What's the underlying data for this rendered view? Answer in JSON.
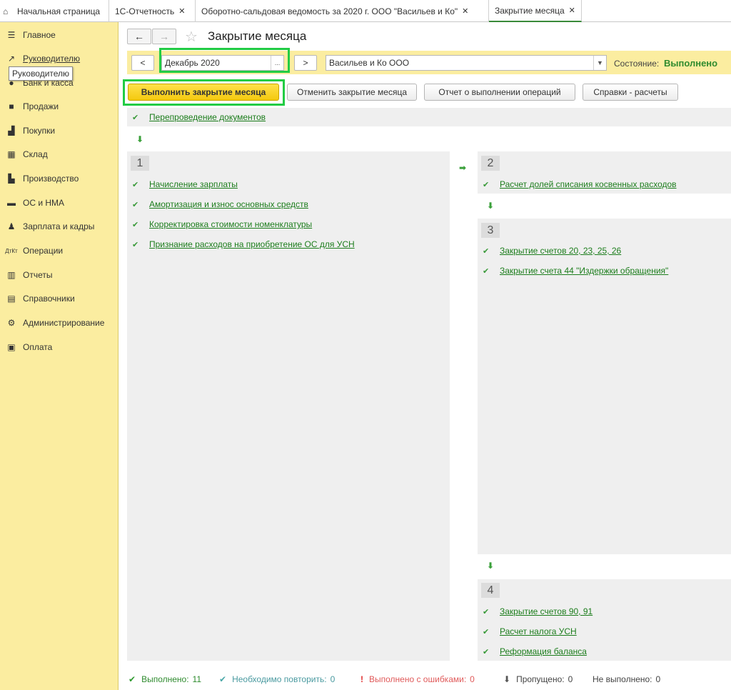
{
  "tabs": [
    {
      "label": "Начальная страница",
      "closable": false,
      "active": false
    },
    {
      "label": "1С-Отчетность",
      "closable": true,
      "active": false
    },
    {
      "label": "Оборотно-сальдовая ведомость за 2020 г. ООО \"Васильев и Ко\"",
      "closable": true,
      "active": false
    },
    {
      "label": "Закрытие месяца",
      "closable": true,
      "active": true
    }
  ],
  "sidebar": {
    "items": [
      {
        "label": "Главное",
        "icon": "menu-icon"
      },
      {
        "label": "Руководителю",
        "icon": "trend-icon"
      },
      {
        "label": "Банк и касса",
        "icon": "bank-icon"
      },
      {
        "label": "Продажи",
        "icon": "bag-icon"
      },
      {
        "label": "Покупки",
        "icon": "cart-icon"
      },
      {
        "label": "Склад",
        "icon": "warehouse-icon"
      },
      {
        "label": "Производство",
        "icon": "factory-icon"
      },
      {
        "label": "ОС и НМА",
        "icon": "truck-icon"
      },
      {
        "label": "Зарплата и кадры",
        "icon": "person-icon"
      },
      {
        "label": "Операции",
        "icon": "dtkt-icon"
      },
      {
        "label": "Отчеты",
        "icon": "chart-icon"
      },
      {
        "label": "Справочники",
        "icon": "books-icon"
      },
      {
        "label": "Администрирование",
        "icon": "gear-icon"
      },
      {
        "label": "Оплата",
        "icon": "wallet-icon"
      }
    ],
    "tooltip": "Руководителю"
  },
  "header": {
    "title": "Закрытие месяца",
    "back": "←",
    "forward": "→"
  },
  "filter": {
    "prev": "<",
    "period": "Декабрь 2020",
    "period_button": "...",
    "next": ">",
    "organization": "Васильев и Ко ООО",
    "state_label": "Состояние:",
    "state_value": "Выполнено"
  },
  "colors": {
    "accent": "#fbeda0",
    "link": "#1c7d1c",
    "ok": "#2e8b2e",
    "highlight": "#22cc44"
  },
  "actions": {
    "run": "Выполнить закрытие месяца",
    "cancel": "Отменить закрытие месяца",
    "report": "Отчет о выполнении операций",
    "refs": "Справки - расчеты"
  },
  "pre_step": {
    "label": "Перепроведение документов"
  },
  "steps": [
    {
      "number": "1",
      "ops": [
        "Начисление зарплаты",
        "Амортизация и износ основных средств",
        "Корректировка стоимости номенклатуры",
        "Признание расходов на приобретение ОС для УСН"
      ]
    },
    {
      "number": "2",
      "ops": [
        "Расчет долей списания косвенных расходов"
      ]
    },
    {
      "number": "3",
      "ops": [
        "Закрытие счетов 20, 23, 25, 26",
        "Закрытие счета 44 \"Издержки обращения\""
      ]
    },
    {
      "number": "4",
      "ops": [
        "Закрытие счетов 90, 91",
        "Расчет налога УСН",
        "Реформация баланса"
      ]
    }
  ],
  "status": {
    "done_label": "Выполнено:",
    "done_count": "11",
    "repeat_label": "Необходимо повторить:",
    "repeat_count": "0",
    "errors_label": "Выполнено с ошибками:",
    "errors_count": "0",
    "skipped_label": "Пропущено:",
    "skipped_count": "0",
    "notdone_label": "Не выполнено:",
    "notdone_count": "0"
  }
}
